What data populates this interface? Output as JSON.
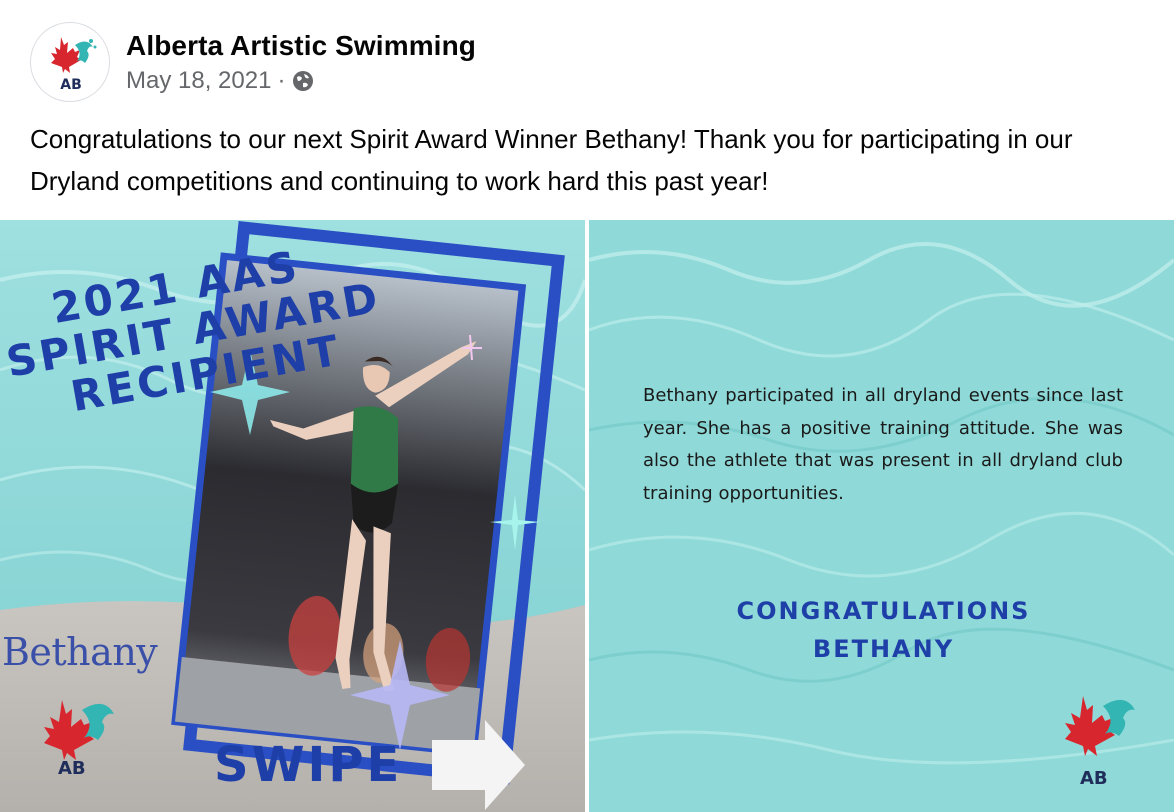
{
  "post": {
    "page_name": "Alberta Artistic Swimming",
    "date": "May 18, 2021",
    "separator": "·",
    "audience_icon": "globe-icon",
    "avatar_text": "AB",
    "caption": "Congratulations to our next Spirit Award Winner Bethany! Thank you for participating in our Dryland competitions and continuing to work hard this past year!"
  },
  "photo_left": {
    "title_line1": "2021 AAS",
    "title_line2": "SPIRIT AWARD",
    "title_line3": "RECIPIENT",
    "name": "Bethany",
    "swipe": "SWIPE",
    "logo_text": "AB"
  },
  "photo_right": {
    "story": "Bethany participated in all dryland events since last year. She has a positive training attitude. She was also the athlete that was present in all dryland club training opportunities.",
    "congrats_line1": "CONGRATULATIONS",
    "congrats_line2": "BETHANY",
    "logo_text": "AB"
  },
  "colors": {
    "pool": "#8fdad8",
    "title_blue": "#1f3fa8",
    "maple_red": "#d8262e",
    "teal_splash": "#33b5b4"
  }
}
